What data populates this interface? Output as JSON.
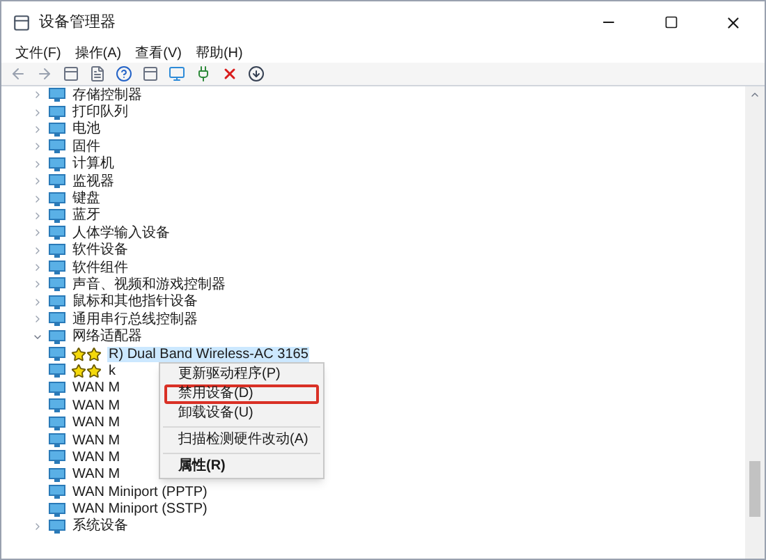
{
  "window": {
    "title": "设备管理器"
  },
  "menu": [
    "文件(F)",
    "操作(A)",
    "查看(V)",
    "帮助(H)"
  ],
  "tree": [
    {
      "label": "存储控制器",
      "expanded": false
    },
    {
      "label": "打印队列",
      "expanded": false
    },
    {
      "label": "电池",
      "expanded": false
    },
    {
      "label": "固件",
      "expanded": false
    },
    {
      "label": "计算机",
      "expanded": false
    },
    {
      "label": "监视器",
      "expanded": false
    },
    {
      "label": "键盘",
      "expanded": false
    },
    {
      "label": "蓝牙",
      "expanded": false
    },
    {
      "label": "人体学输入设备",
      "expanded": false
    },
    {
      "label": "软件设备",
      "expanded": false
    },
    {
      "label": "软件组件",
      "expanded": false
    },
    {
      "label": "声音、视频和游戏控制器",
      "expanded": false
    },
    {
      "label": "鼠标和其他指针设备",
      "expanded": false
    },
    {
      "label": "通用串行总线控制器",
      "expanded": false
    },
    {
      "label": "网络适配器",
      "expanded": true,
      "children": [
        {
          "label": "R) Dual Band Wireless-AC 3165",
          "selected": true,
          "redacted": true
        },
        {
          "label": "k",
          "selected": false,
          "redacted": true
        },
        {
          "label": "WAN M",
          "selected": false,
          "redacted": false
        },
        {
          "label": "WAN M",
          "selected": false,
          "redacted": false
        },
        {
          "label": "WAN M",
          "selected": false,
          "redacted": false
        },
        {
          "label": "WAN M",
          "selected": false,
          "redacted": false
        },
        {
          "label": "WAN M",
          "selected": false,
          "redacted": false
        },
        {
          "label": "WAN M",
          "selected": false,
          "redacted": false
        },
        {
          "label": "WAN Miniport (PPTP)",
          "selected": false,
          "redacted": false
        },
        {
          "label": "WAN Miniport (SSTP)",
          "selected": false,
          "redacted": false
        }
      ]
    },
    {
      "label": "系统设备",
      "expanded": false
    }
  ],
  "context_menu": [
    {
      "kind": "item",
      "label": "更新驱动程序(P)",
      "marked": false,
      "bold": false
    },
    {
      "kind": "item",
      "label": "禁用设备(D)",
      "marked": true,
      "bold": false
    },
    {
      "kind": "item",
      "label": "卸载设备(U)",
      "marked": false,
      "bold": false
    },
    {
      "kind": "separator"
    },
    {
      "kind": "item",
      "label": "扫描检测硬件改动(A)",
      "marked": false,
      "bold": false
    },
    {
      "kind": "separator"
    },
    {
      "kind": "item",
      "label": "属性(R)",
      "marked": false,
      "bold": true
    }
  ]
}
